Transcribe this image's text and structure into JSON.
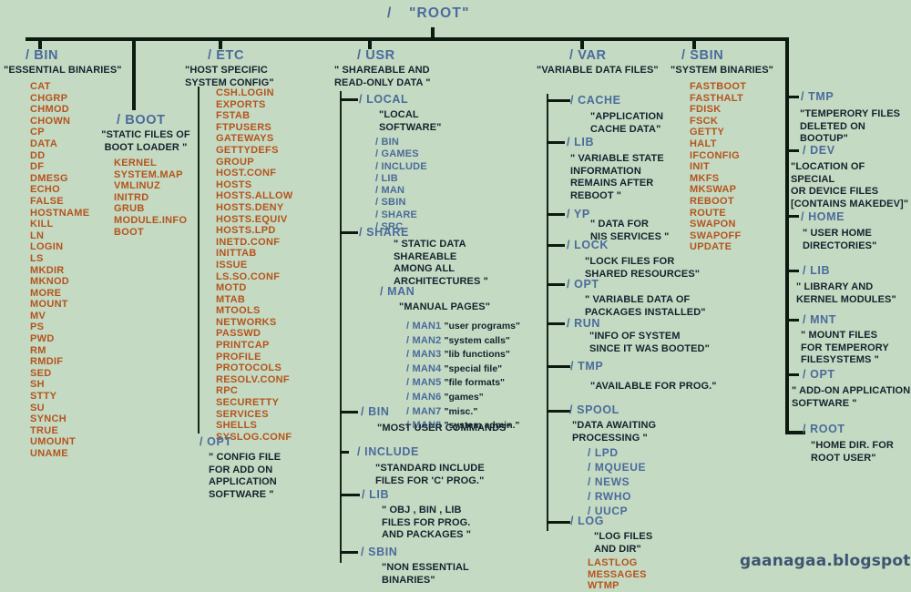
{
  "title": {
    "slash": "/",
    "label": "\"ROOT\""
  },
  "watermark": "gaanagaa.blogspot.com",
  "colors": {
    "background": "#c5dac2",
    "directory": "#4a6b9c",
    "description": "#15232e",
    "file": "#b4541e",
    "line": "#0d1a10",
    "watermark": "#3c5572"
  },
  "nodes": {
    "bin": {
      "name": "/ BIN",
      "desc": "\"ESSENTIAL BINARIES\"",
      "files": "CAT\nCHGRP\nCHMOD\nCHOWN\nCP\nDATA\nDD\nDF\nDMESG\nECHO\nFALSE\nHOSTNAME\nKILL\nLN\nLOGIN\nLS\nMKDIR\nMKNOD\nMORE\nMOUNT\nMV\nPS\nPWD\nRM\nRMDIF\nSED\nSH\nSTTY\nSU\nSYNCH\nTRUE\nUMOUNT\nUNAME"
    },
    "boot": {
      "name": "/ BOOT",
      "desc": "\"STATIC FILES OF\nBOOT LOADER \"",
      "files": "KERNEL\nSYSTEM.MAP\nVMLINUZ\nINITRD\nGRUB\nMODULE.INFO\nBOOT"
    },
    "etc": {
      "name": "/ ETC",
      "desc": "\"HOST SPECIFIC\nSYSTEM CONFIG\"",
      "files": "CSH.LOGIN\nEXPORTS\nFSTAB\nFTPUSERS\nGATEWAYS\nGETTYDEFS\nGROUP\nHOST.CONF\nHOSTS\nHOSTS.ALLOW\nHOSTS.DENY\nHOSTS.EQUIV\nHOSTS.LPD\nINETD.CONF\nINITTAB\nISSUE\nLS.SO.CONF\nMOTD\nMTAB\nMTOOLS\nNETWORKS\nPASSWD\nPRINTCAP\nPROFILE\nPROTOCOLS\nRESOLV.CONF\nRPC\nSECURETTY\nSERVICES\nSHELLS\nSYSLOG.CONF"
    },
    "etc_opt": {
      "name": "/ OPT",
      "desc": "\" CONFIG FILE\n FOR ADD ON\n APPLICATION\n   SOFTWARE \""
    },
    "usr": {
      "name": "/ USR",
      "desc": "\" SHAREABLE AND\nREAD-ONLY DATA \""
    },
    "usr_local": {
      "name": "/ LOCAL",
      "desc": "\"LOCAL\n SOFTWARE\"",
      "subdirs": "/ BIN\n/ GAMES\n/ INCLUDE\n/ LIB\n/ MAN\n/ SBIN\n/ SHARE\n/ SRC"
    },
    "usr_share": {
      "name": "/ SHARE",
      "desc": "\" STATIC DATA\n SHAREABLE\n AMONG ALL\nARCHITECTURES \""
    },
    "usr_man": {
      "name": "/ MAN",
      "desc": "\"MANUAL PAGES\"",
      "sections": [
        {
          "dir": "/ MAN1",
          "note": "\"user programs\""
        },
        {
          "dir": "/ MAN2",
          "note": "\"system calls\""
        },
        {
          "dir": "/ MAN3",
          "note": "\"lib functions\""
        },
        {
          "dir": "/ MAN4",
          "note": "\"special file\""
        },
        {
          "dir": "/ MAN5",
          "note": "\"file formats\""
        },
        {
          "dir": "/ MAN6",
          "note": "\"games\""
        },
        {
          "dir": "/ MAN7",
          "note": "\"misc.\""
        },
        {
          "dir": "/ MAN8",
          "note": "\"system admin.\""
        }
      ]
    },
    "usr_bin": {
      "name": "/ BIN",
      "desc": "\"MOST USER COMMANDS\""
    },
    "usr_include": {
      "name": "/ INCLUDE",
      "desc": "\"STANDARD INCLUDE\n FILES FOR  'C' PROG.\""
    },
    "usr_lib": {
      "name": "/ LIB",
      "desc": "\" OBJ , BIN , LIB\n FILES FOR PROG.\n AND PACKAGES \""
    },
    "usr_sbin": {
      "name": "/ SBIN",
      "desc": "\"NON ESSENTIAL\n BINARIES\""
    },
    "var": {
      "name": "/ VAR",
      "desc": "\"VARIABLE DATA FILES\""
    },
    "var_cache": {
      "name": "/ CACHE",
      "desc": "\"APPLICATION\nCACHE DATA\""
    },
    "var_lib": {
      "name": "/ LIB",
      "desc": "\" VARIABLE STATE\n  INFORMATION\nREMAINS  AFTER\n    REBOOT \""
    },
    "var_yp": {
      "name": "/ YP",
      "desc": "\" DATA FOR\nNIS SERVICES \""
    },
    "var_lock": {
      "name": "/ LOCK",
      "desc": "\"LOCK FILES FOR\nSHARED RESOURCES\""
    },
    "var_opt": {
      "name": "/ OPT",
      "desc": "\" VARIABLE DATA OF\nPACKAGES INSTALLED\""
    },
    "var_run": {
      "name": "/ RUN",
      "desc": "\"INFO OF SYSTEM\n SINCE IT WAS BOOTED\""
    },
    "var_tmp": {
      "name": "/ TMP",
      "desc": "\"AVAILABLE FOR PROG.\""
    },
    "var_spool": {
      "name": "/ SPOOL",
      "desc": "\"DATA AWAITING\n PROCESSING \"",
      "subdirs": "/ LPD\n/ MQUEUE\n/ NEWS\n/ RWHO\n/ UUCP"
    },
    "var_log": {
      "name": "/ LOG",
      "desc": "\"LOG FILES\n  AND DIR\"",
      "files": "LASTLOG\nMESSAGES\nWTMP"
    },
    "sbin": {
      "name": "/ SBIN",
      "desc": "\"SYSTEM BINARIES\"",
      "files": "FASTBOOT\nFASTHALT\nFDISK\nFSCK\nGETTY\nHALT\nIFCONFIG\nINIT\nMKFS\nMKSWAP\nREBOOT\nROUTE\nSWAPON\nSWAPOFF\nUPDATE"
    },
    "tmp": {
      "name": "/ TMP",
      "desc": "\"TEMPERORY FILES\nDELETED ON BOOTUP\""
    },
    "dev": {
      "name": "/ DEV",
      "desc": "\"LOCATION OF SPECIAL\n  OR DEVICE FILES\n[CONTAINS MAKEDEV]\""
    },
    "home": {
      "name": "/ HOME",
      "desc": "\" USER HOME\n DIRECTORIES\""
    },
    "lib": {
      "name": "/ LIB",
      "desc": "\"  LIBRARY AND\nKERNEL MODULES\""
    },
    "mnt": {
      "name": "/ MNT",
      "desc": "\"  MOUNT FILES\n FOR TEMPERORY\n FILESYSTEMS \""
    },
    "opt": {
      "name": "/ OPT",
      "desc": "\" ADD-ON APPLICATION\n  SOFTWARE \""
    },
    "root": {
      "name": "/ ROOT",
      "desc": "\"HOME DIR. FOR\n ROOT USER\""
    }
  }
}
